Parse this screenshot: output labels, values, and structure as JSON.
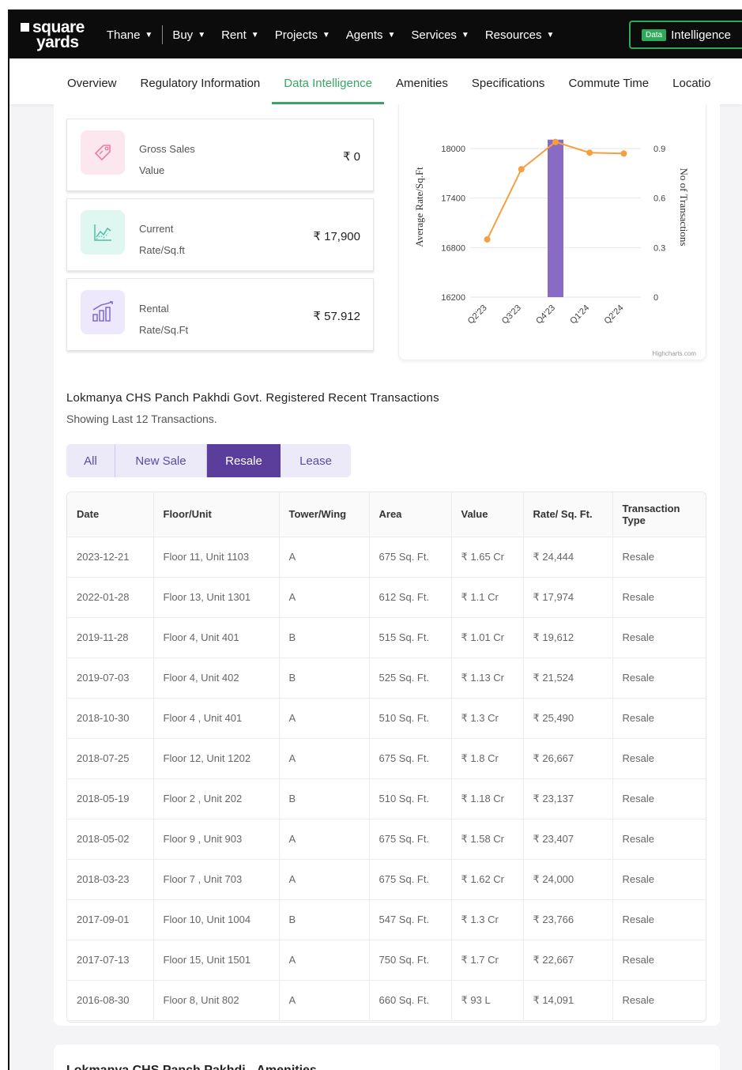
{
  "brand": {
    "line1": "square",
    "line2": "yards"
  },
  "nav": {
    "city": "Thane",
    "items": [
      "Buy",
      "Rent",
      "Projects",
      "Agents",
      "Services",
      "Resources"
    ],
    "intel_pill": "Data",
    "intel_label": "Intelligence"
  },
  "subnav": {
    "tabs": [
      "Overview",
      "Regulatory Information",
      "Data Intelligence",
      "Amenities",
      "Specifications",
      "Commute Time",
      "Locatio"
    ],
    "active": "Data Intelligence"
  },
  "cards": [
    {
      "label_l1": "Gross Sales",
      "label_l2": "Value",
      "value": "₹ 0",
      "icon": "tag-icon"
    },
    {
      "label_l1": "Current",
      "label_l2": "Rate/Sq.ft",
      "value": "₹ 17,900",
      "icon": "line-chart-icon"
    },
    {
      "label_l1": "Rental",
      "label_l2": "Rate/Sq.Ft",
      "value": "₹ 57.912",
      "icon": "bar-chart-icon"
    }
  ],
  "chart_data": {
    "type": "bar",
    "categories": [
      "Q2'23",
      "Q3'23",
      "Q4'23",
      "Q1'24",
      "Q2'24"
    ],
    "series": [
      {
        "type": "bar",
        "axis": "right",
        "values": [
          0,
          0,
          1,
          0,
          0
        ],
        "color": "#8a6bc4"
      },
      {
        "type": "line",
        "axis": "left",
        "values": [
          16900,
          17750,
          18080,
          17950,
          17940
        ],
        "color": "#f5a040"
      }
    ],
    "ylabel": "Average Rate/Sq.Ft",
    "y2label": "No of Transactions",
    "ylim": [
      16200,
      18000
    ],
    "y_ticks": [
      "18000",
      "17400",
      "16800",
      "16200"
    ],
    "y2_ticks": [
      "0.9",
      "0.6",
      "0.3",
      "0"
    ],
    "credit": "Highcharts.com",
    "grid": true
  },
  "transactions": {
    "title": "Lokmanya CHS Panch Pakhdi Govt. Registered Recent Transactions",
    "subtitle": "Showing Last 12 Transactions.",
    "filters": [
      "All",
      "New Sale",
      "Resale",
      "Lease"
    ],
    "active_filter": "Resale",
    "columns": [
      "Date",
      "Floor/Unit",
      "Tower/Wing",
      "Area",
      "Value",
      "Rate/ Sq. Ft.",
      "Transaction Type"
    ],
    "rows": [
      [
        "2023-12-21",
        "Floor 11, Unit 1103",
        "A",
        "675 Sq. Ft.",
        "₹ 1.65 Cr",
        "₹ 24,444",
        "Resale"
      ],
      [
        "2022-01-28",
        "Floor 13, Unit 1301",
        "A",
        "612 Sq. Ft.",
        "₹ 1.1 Cr",
        "₹ 17,974",
        "Resale"
      ],
      [
        "2019-11-28",
        "Floor 4, Unit 401",
        "B",
        "515 Sq. Ft.",
        "₹ 1.01 Cr",
        "₹ 19,612",
        "Resale"
      ],
      [
        "2019-07-03",
        "Floor 4, Unit 402",
        "B",
        "525 Sq. Ft.",
        "₹ 1.13 Cr",
        "₹ 21,524",
        "Resale"
      ],
      [
        "2018-10-30",
        "Floor 4 , Unit 401",
        "A",
        "510 Sq. Ft.",
        "₹ 1.3 Cr",
        "₹ 25,490",
        "Resale"
      ],
      [
        "2018-07-25",
        "Floor 12, Unit 1202",
        "A",
        "675 Sq. Ft.",
        "₹ 1.8 Cr",
        "₹ 26,667",
        "Resale"
      ],
      [
        "2018-05-19",
        "Floor 2 , Unit 202",
        "B",
        "510 Sq. Ft.",
        "₹ 1.18 Cr",
        "₹ 23,137",
        "Resale"
      ],
      [
        "2018-05-02",
        "Floor 9 , Unit 903",
        "A",
        "675 Sq. Ft.",
        "₹ 1.58 Cr",
        "₹ 23,407",
        "Resale"
      ],
      [
        "2018-03-23",
        "Floor 7 , Unit 703",
        "A",
        "675 Sq. Ft.",
        "₹ 1.62 Cr",
        "₹ 24,000",
        "Resale"
      ],
      [
        "2017-09-01",
        "Floor 10, Unit 1004",
        "B",
        "547 Sq. Ft.",
        "₹ 1.3 Cr",
        "₹ 23,766",
        "Resale"
      ],
      [
        "2017-07-13",
        "Floor 15, Unit 1501",
        "A",
        "750 Sq. Ft.",
        "₹ 1.7 Cr",
        "₹ 22,667",
        "Resale"
      ],
      [
        "2016-08-30",
        "Floor 8, Unit 802",
        "A",
        "660 Sq. Ft.",
        "₹ 93 L",
        "₹ 14,091",
        "Resale"
      ]
    ]
  },
  "amenities": {
    "title": "Lokmanya CHS Panch Pakhdi - Amenities"
  }
}
